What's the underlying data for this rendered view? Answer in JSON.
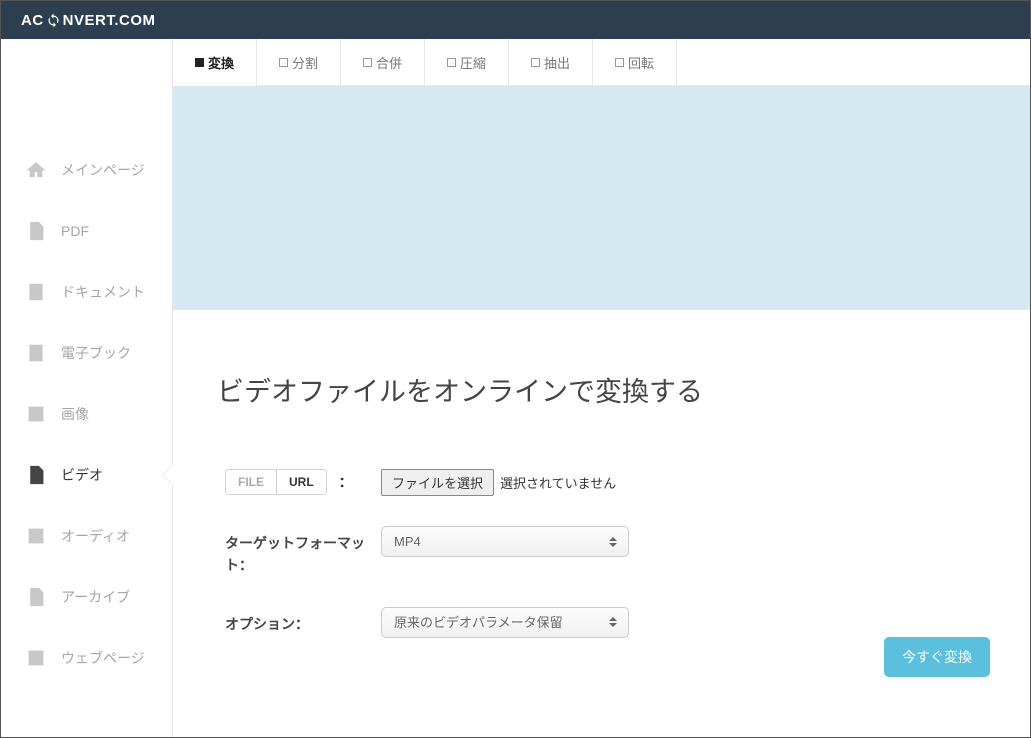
{
  "header": {
    "logo_left": "AC",
    "logo_right": "NVERT.COM"
  },
  "sidebar": {
    "items": [
      {
        "label": "メインページ",
        "icon": "home"
      },
      {
        "label": "PDF",
        "icon": "pdf"
      },
      {
        "label": "ドキュメント",
        "icon": "document"
      },
      {
        "label": "電子ブック",
        "icon": "ebook"
      },
      {
        "label": "画像",
        "icon": "image"
      },
      {
        "label": "ビデオ",
        "icon": "video"
      },
      {
        "label": "オーディオ",
        "icon": "audio"
      },
      {
        "label": "アーカイブ",
        "icon": "archive"
      },
      {
        "label": "ウェブページ",
        "icon": "webpage"
      }
    ]
  },
  "tabs": {
    "items": [
      {
        "label": "変換",
        "active": true
      },
      {
        "label": "分割",
        "active": false
      },
      {
        "label": "合併",
        "active": false
      },
      {
        "label": "圧縮",
        "active": false
      },
      {
        "label": "抽出",
        "active": false
      },
      {
        "label": "回転",
        "active": false
      }
    ]
  },
  "page": {
    "heading": "ビデオファイルをオンラインで変換する"
  },
  "source": {
    "file_tab": "FILE",
    "url_tab": "URL",
    "colon": "：",
    "choose_button": "ファイルを選択",
    "no_file": "選択されていません"
  },
  "format": {
    "label": "ターゲットフォーマット：",
    "value": "MP4"
  },
  "options": {
    "label": "オプション：",
    "value": "原来のビデオパラメータ保留"
  },
  "actions": {
    "convert_now": "今すぐ変換"
  }
}
